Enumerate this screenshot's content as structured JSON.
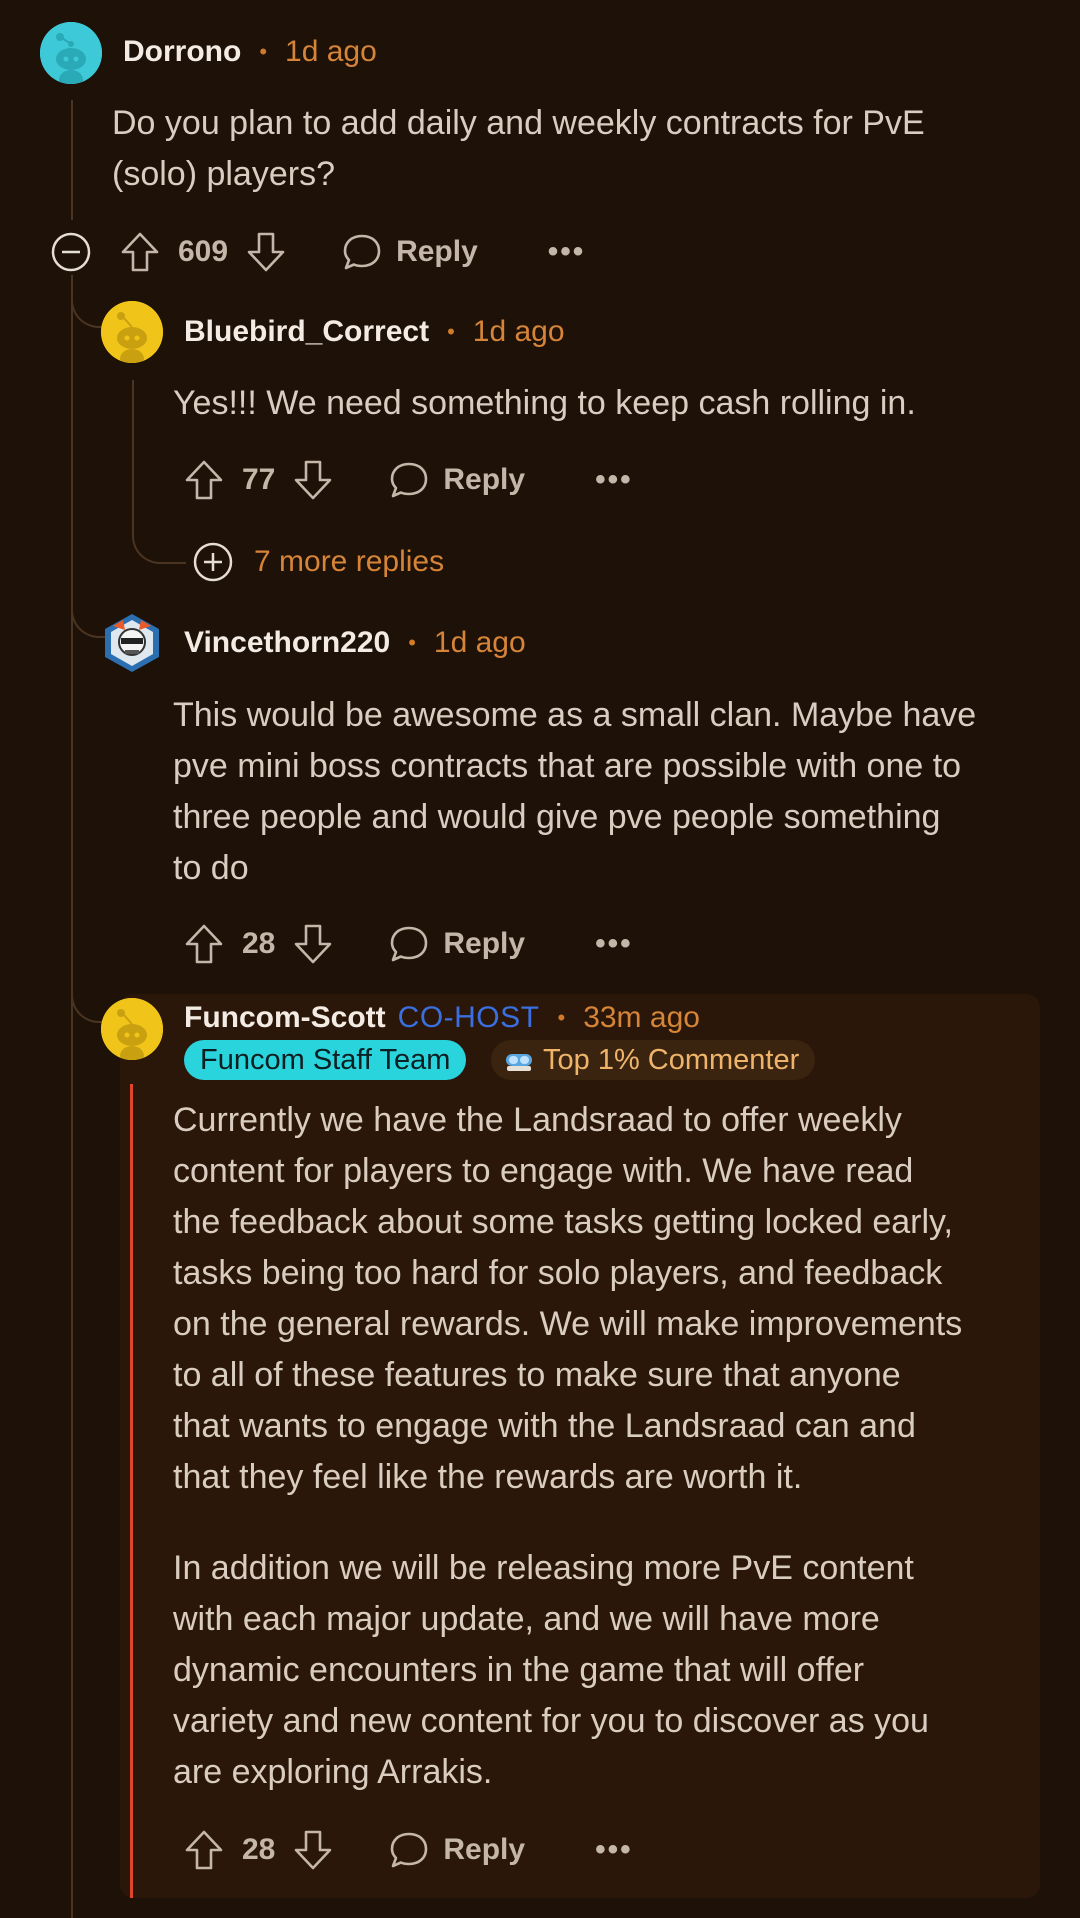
{
  "comments": [
    {
      "username": "Dorrono",
      "time": "1d ago",
      "text": [
        "Do you plan to add daily and weekly contracts for PvE",
        "(solo) players?"
      ],
      "votes": "609",
      "reply_label": "Reply",
      "more_label": "•••"
    },
    {
      "username": "Bluebird_Correct",
      "time": "1d ago",
      "text": [
        "Yes!!! We need something to keep cash rolling in."
      ],
      "votes": "77",
      "reply_label": "Reply",
      "more_label": "•••",
      "more_replies": "7 more replies"
    },
    {
      "username": "Vincethorn220",
      "time": "1d ago",
      "text": [
        "This would be awesome as a small clan. Maybe have",
        "pve mini boss contracts that are possible with one to",
        "three people and would give pve people something",
        "to do"
      ],
      "votes": "28",
      "reply_label": "Reply",
      "more_label": "•••"
    },
    {
      "username": "Funcom-Scott",
      "role": "CO-HOST",
      "time": "33m ago",
      "flair_staff": "Funcom Staff Team",
      "flair_top": "Top 1% Commenter",
      "paragraph1": [
        "Currently we have the Landsraad to offer weekly",
        "content for players to engage with. We have read",
        "the feedback about some tasks getting locked early,",
        "tasks being too hard for solo players, and feedback",
        "on the general rewards. We will make improvements",
        "to all of these features to make sure that anyone",
        "that wants to engage with the Landsraad can and",
        "that they feel like the rewards are worth it."
      ],
      "paragraph2": [
        "In addition we will be releasing more PvE content",
        "with each major update, and we will have more",
        "dynamic encounters in the game that will offer",
        "variety and new content for you to discover as you",
        "are exploring Arrakis."
      ],
      "votes": "28",
      "reply_label": "Reply",
      "more_label": "•••"
    }
  ],
  "colors": {
    "background": "#1e1108",
    "time": "#d58438",
    "cohost": "#3a6fe0",
    "staff_flair": "#2ad4dc",
    "highlight_line": "#e0452a"
  },
  "icons": [
    "collapse-icon",
    "upvote-icon",
    "downvote-icon",
    "comment-bubble-icon",
    "expand-plus-icon",
    "snoo-avatar-icon"
  ]
}
